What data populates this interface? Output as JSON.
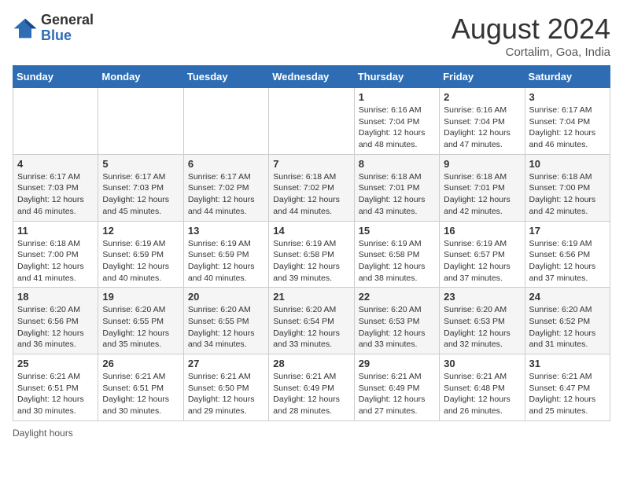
{
  "header": {
    "logo_general": "General",
    "logo_blue": "Blue",
    "month_title": "August 2024",
    "location": "Cortalim, Goa, India"
  },
  "days_of_week": [
    "Sunday",
    "Monday",
    "Tuesday",
    "Wednesday",
    "Thursday",
    "Friday",
    "Saturday"
  ],
  "footer": {
    "note": "Daylight hours"
  },
  "weeks": [
    [
      {
        "day": "",
        "info": ""
      },
      {
        "day": "",
        "info": ""
      },
      {
        "day": "",
        "info": ""
      },
      {
        "day": "",
        "info": ""
      },
      {
        "day": "1",
        "info": "Sunrise: 6:16 AM\nSunset: 7:04 PM\nDaylight: 12 hours\nand 48 minutes."
      },
      {
        "day": "2",
        "info": "Sunrise: 6:16 AM\nSunset: 7:04 PM\nDaylight: 12 hours\nand 47 minutes."
      },
      {
        "day": "3",
        "info": "Sunrise: 6:17 AM\nSunset: 7:04 PM\nDaylight: 12 hours\nand 46 minutes."
      }
    ],
    [
      {
        "day": "4",
        "info": "Sunrise: 6:17 AM\nSunset: 7:03 PM\nDaylight: 12 hours\nand 46 minutes."
      },
      {
        "day": "5",
        "info": "Sunrise: 6:17 AM\nSunset: 7:03 PM\nDaylight: 12 hours\nand 45 minutes."
      },
      {
        "day": "6",
        "info": "Sunrise: 6:17 AM\nSunset: 7:02 PM\nDaylight: 12 hours\nand 44 minutes."
      },
      {
        "day": "7",
        "info": "Sunrise: 6:18 AM\nSunset: 7:02 PM\nDaylight: 12 hours\nand 44 minutes."
      },
      {
        "day": "8",
        "info": "Sunrise: 6:18 AM\nSunset: 7:01 PM\nDaylight: 12 hours\nand 43 minutes."
      },
      {
        "day": "9",
        "info": "Sunrise: 6:18 AM\nSunset: 7:01 PM\nDaylight: 12 hours\nand 42 minutes."
      },
      {
        "day": "10",
        "info": "Sunrise: 6:18 AM\nSunset: 7:00 PM\nDaylight: 12 hours\nand 42 minutes."
      }
    ],
    [
      {
        "day": "11",
        "info": "Sunrise: 6:18 AM\nSunset: 7:00 PM\nDaylight: 12 hours\nand 41 minutes."
      },
      {
        "day": "12",
        "info": "Sunrise: 6:19 AM\nSunset: 6:59 PM\nDaylight: 12 hours\nand 40 minutes."
      },
      {
        "day": "13",
        "info": "Sunrise: 6:19 AM\nSunset: 6:59 PM\nDaylight: 12 hours\nand 40 minutes."
      },
      {
        "day": "14",
        "info": "Sunrise: 6:19 AM\nSunset: 6:58 PM\nDaylight: 12 hours\nand 39 minutes."
      },
      {
        "day": "15",
        "info": "Sunrise: 6:19 AM\nSunset: 6:58 PM\nDaylight: 12 hours\nand 38 minutes."
      },
      {
        "day": "16",
        "info": "Sunrise: 6:19 AM\nSunset: 6:57 PM\nDaylight: 12 hours\nand 37 minutes."
      },
      {
        "day": "17",
        "info": "Sunrise: 6:19 AM\nSunset: 6:56 PM\nDaylight: 12 hours\nand 37 minutes."
      }
    ],
    [
      {
        "day": "18",
        "info": "Sunrise: 6:20 AM\nSunset: 6:56 PM\nDaylight: 12 hours\nand 36 minutes."
      },
      {
        "day": "19",
        "info": "Sunrise: 6:20 AM\nSunset: 6:55 PM\nDaylight: 12 hours\nand 35 minutes."
      },
      {
        "day": "20",
        "info": "Sunrise: 6:20 AM\nSunset: 6:55 PM\nDaylight: 12 hours\nand 34 minutes."
      },
      {
        "day": "21",
        "info": "Sunrise: 6:20 AM\nSunset: 6:54 PM\nDaylight: 12 hours\nand 33 minutes."
      },
      {
        "day": "22",
        "info": "Sunrise: 6:20 AM\nSunset: 6:53 PM\nDaylight: 12 hours\nand 33 minutes."
      },
      {
        "day": "23",
        "info": "Sunrise: 6:20 AM\nSunset: 6:53 PM\nDaylight: 12 hours\nand 32 minutes."
      },
      {
        "day": "24",
        "info": "Sunrise: 6:20 AM\nSunset: 6:52 PM\nDaylight: 12 hours\nand 31 minutes."
      }
    ],
    [
      {
        "day": "25",
        "info": "Sunrise: 6:21 AM\nSunset: 6:51 PM\nDaylight: 12 hours\nand 30 minutes."
      },
      {
        "day": "26",
        "info": "Sunrise: 6:21 AM\nSunset: 6:51 PM\nDaylight: 12 hours\nand 30 minutes."
      },
      {
        "day": "27",
        "info": "Sunrise: 6:21 AM\nSunset: 6:50 PM\nDaylight: 12 hours\nand 29 minutes."
      },
      {
        "day": "28",
        "info": "Sunrise: 6:21 AM\nSunset: 6:49 PM\nDaylight: 12 hours\nand 28 minutes."
      },
      {
        "day": "29",
        "info": "Sunrise: 6:21 AM\nSunset: 6:49 PM\nDaylight: 12 hours\nand 27 minutes."
      },
      {
        "day": "30",
        "info": "Sunrise: 6:21 AM\nSunset: 6:48 PM\nDaylight: 12 hours\nand 26 minutes."
      },
      {
        "day": "31",
        "info": "Sunrise: 6:21 AM\nSunset: 6:47 PM\nDaylight: 12 hours\nand 25 minutes."
      }
    ]
  ]
}
